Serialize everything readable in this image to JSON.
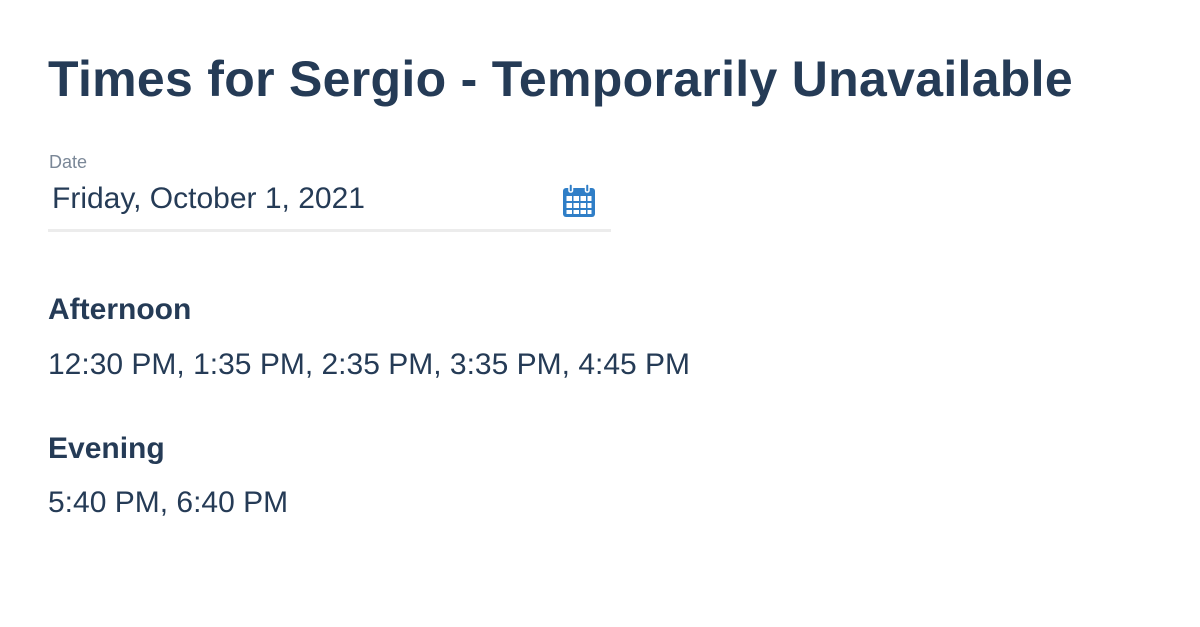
{
  "page": {
    "title": "Times for Sergio - Temporarily Unavailable"
  },
  "date_field": {
    "label": "Date",
    "value": "Friday, October 1, 2021",
    "icon": "calendar-icon"
  },
  "sections": [
    {
      "heading": "Afternoon",
      "times": [
        "12:30 PM",
        "1:35 PM",
        "2:35 PM",
        "3:35 PM",
        "4:45 PM"
      ]
    },
    {
      "heading": "Evening",
      "times": [
        "5:40 PM",
        "6:40 PM"
      ]
    }
  ],
  "colors": {
    "text": "#253b56",
    "label": "#7a8797",
    "accent": "#2f7ec7",
    "underline": "#ececec"
  }
}
